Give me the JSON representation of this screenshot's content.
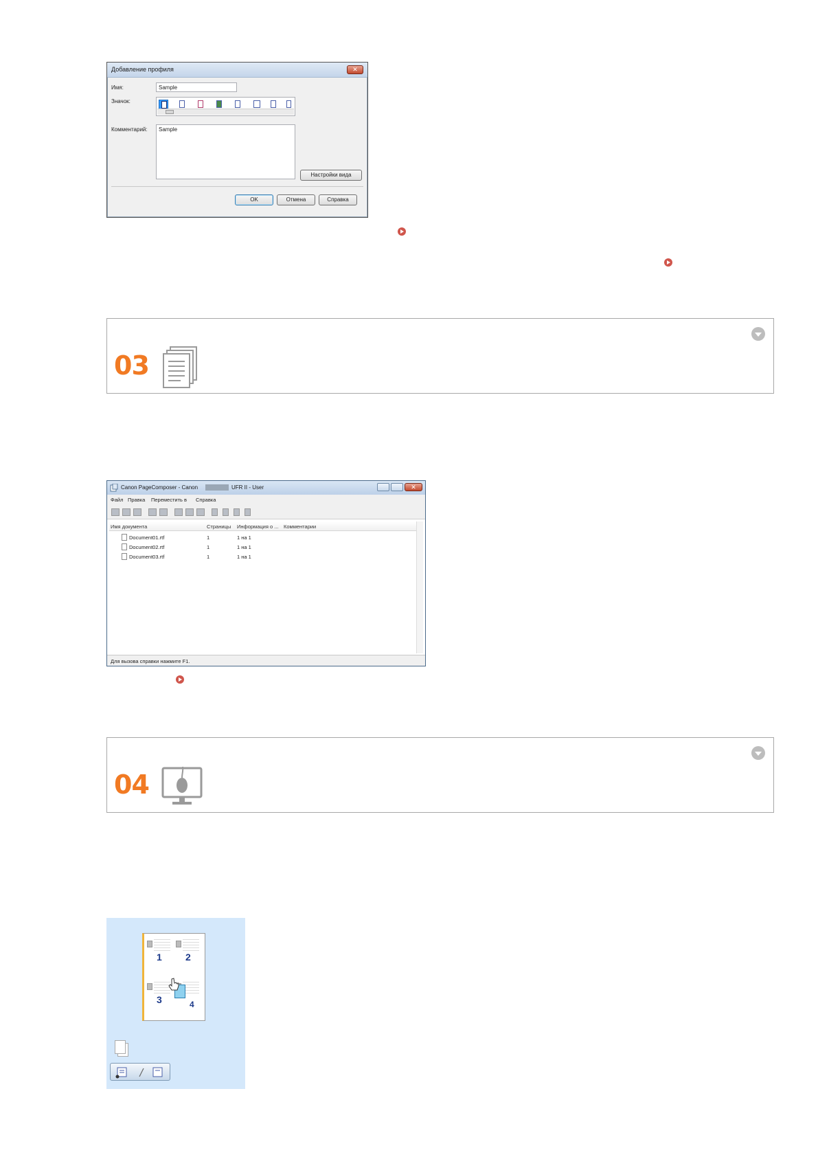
{
  "dialog_add_profile": {
    "title": "Добавление профиля",
    "close_label": "✕",
    "name_label": "Имя:",
    "name_value": "Sample",
    "icon_label": "Значок:",
    "comment_label": "Комментарий:",
    "comment_value": "Sample",
    "view_settings_button": "Настройки вида",
    "ok_button": "OK",
    "cancel_button": "Отмена",
    "help_button": "Справка"
  },
  "steps": [
    {
      "number": "03",
      "icon": "document-stack-icon"
    },
    {
      "number": "04",
      "icon": "monitor-mouse-icon"
    }
  ],
  "page_composer": {
    "title": "Canon PageComposer - Canon",
    "title_suffix": "UFR II - User",
    "menu": [
      "Файл",
      "Правка",
      "Переместить в",
      "Справка"
    ],
    "columns": [
      "Имя документа",
      "Страницы",
      "Информация о ...",
      "Комментарии"
    ],
    "rows": [
      {
        "name": "Document01.rtf",
        "pages": "1",
        "info": "1 на 1"
      },
      {
        "name": "Document02.rtf",
        "pages": "1",
        "info": "1 на 1"
      },
      {
        "name": "Document03.rtf",
        "pages": "1",
        "info": "1 на 1"
      }
    ],
    "status": "Для вызова справки нажмите F1."
  },
  "layout_preview": {
    "page_numbers": [
      "1",
      "2",
      "3",
      "4"
    ]
  },
  "colors": {
    "step_number": "#f17a23",
    "link_arrow": "#d0564c",
    "preview_bg": "#d4e8fb"
  }
}
